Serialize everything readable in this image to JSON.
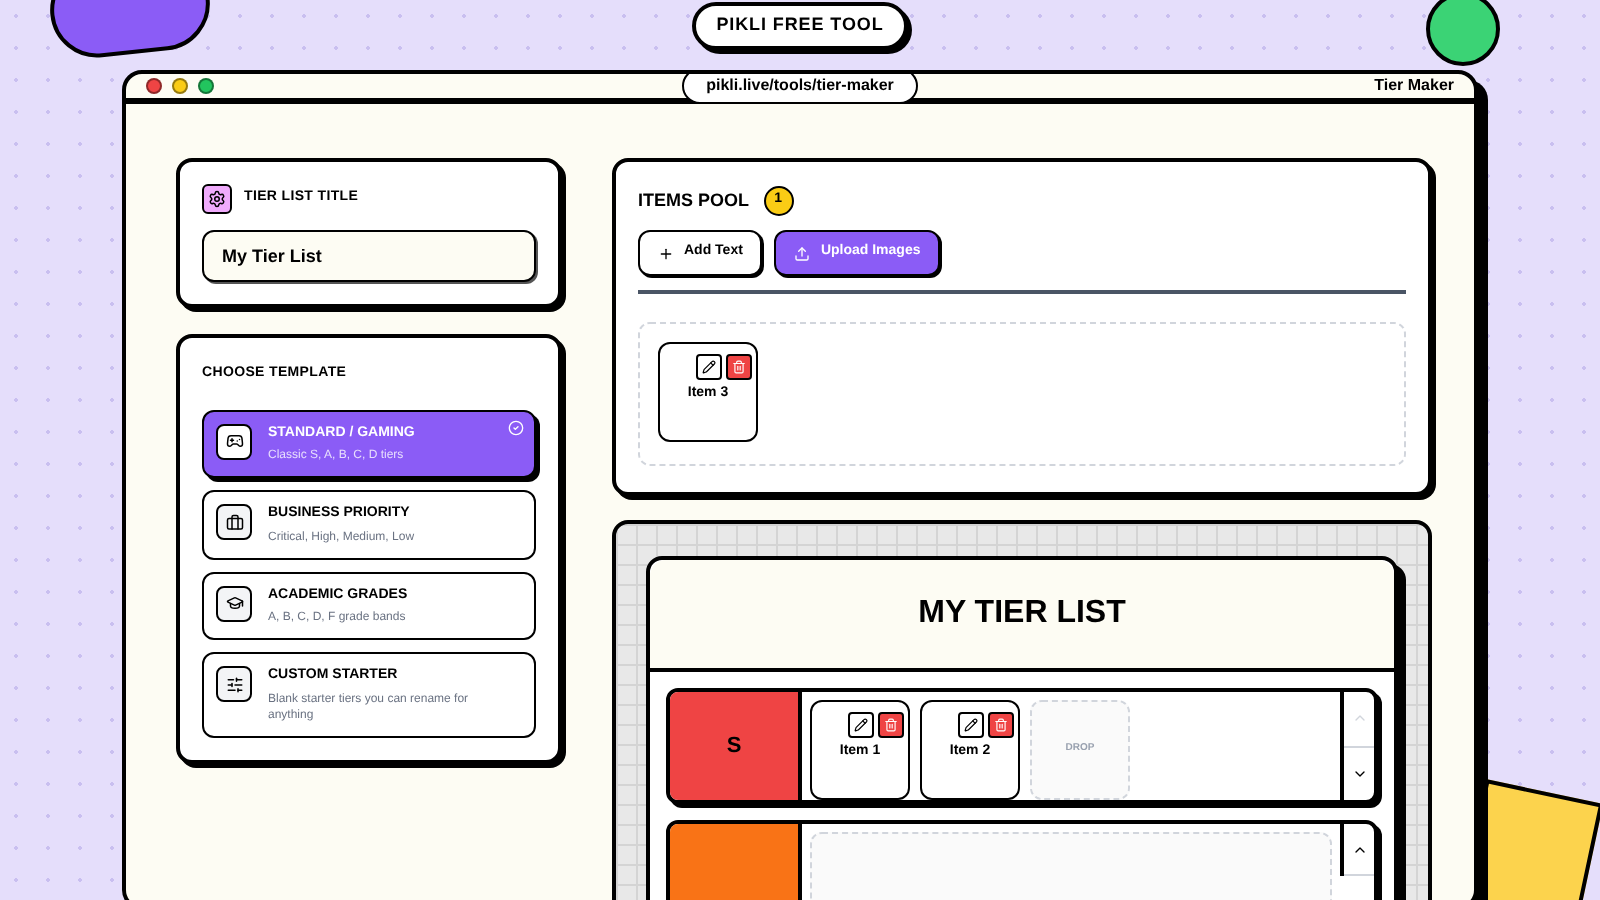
{
  "badge": "PIKLI FREE TOOL",
  "window": {
    "url": "pikli.live/tools/tier-maker",
    "title": "Tier Maker"
  },
  "title_card": {
    "label": "TIER LIST TITLE",
    "value": "My Tier List"
  },
  "templates": {
    "heading": "CHOOSE TEMPLATE",
    "items": [
      {
        "name": "STANDARD / GAMING",
        "desc": "Classic S, A, B, C, D tiers",
        "selected": true
      },
      {
        "name": "BUSINESS PRIORITY",
        "desc": "Critical, High, Medium, Low",
        "selected": false
      },
      {
        "name": "ACADEMIC GRADES",
        "desc": "A, B, C, D, F grade bands",
        "selected": false
      },
      {
        "name": "CUSTOM STARTER",
        "desc": "Blank starter tiers you can rename for anything",
        "selected": false
      }
    ]
  },
  "pool": {
    "title": "ITEMS POOL",
    "count": "1",
    "buttons": [
      {
        "label": "Add Text",
        "kind": "secondary"
      },
      {
        "label": "Upload Images",
        "kind": "primary"
      }
    ],
    "items": [
      {
        "label": "Item 3"
      }
    ]
  },
  "board": {
    "title": "MY TIER LIST",
    "tiers": [
      {
        "label": "S",
        "color": "#ef4444",
        "items": [
          {
            "label": "Item 1"
          },
          {
            "label": "Item 2"
          }
        ],
        "drop": "DROP",
        "up_enabled": false
      },
      {
        "color": "#f97316",
        "up_enabled": true
      }
    ]
  }
}
